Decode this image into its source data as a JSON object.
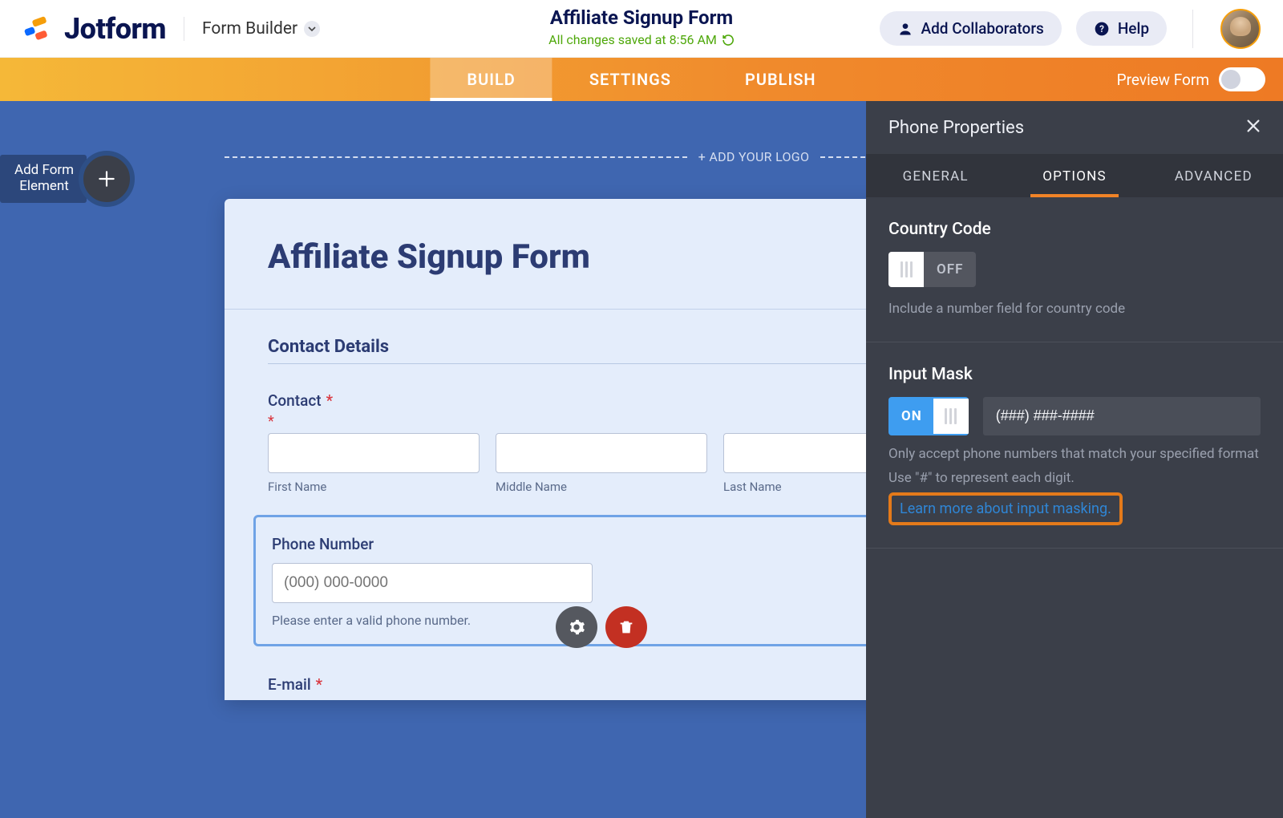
{
  "header": {
    "brand": "Jotform",
    "builder_label": "Form Builder",
    "form_title": "Affiliate Signup Form",
    "saved_text": "All changes saved at 8:56 AM",
    "collaborators_label": "Add Collaborators",
    "help_label": "Help"
  },
  "modebar": {
    "tabs": [
      "BUILD",
      "SETTINGS",
      "PUBLISH"
    ],
    "active": "BUILD",
    "preview_label": "Preview Form"
  },
  "side": {
    "add_label_1": "Add Form",
    "add_label_2": "Element"
  },
  "canvas": {
    "add_logo": "+ ADD YOUR LOGO",
    "form_heading": "Affiliate Signup Form",
    "section_contact_details": "Contact Details",
    "contact_label": "Contact",
    "sub_first": "First Name",
    "sub_middle": "Middle Name",
    "sub_last": "Last Name",
    "phone_label": "Phone Number",
    "phone_placeholder": "(000) 000-0000",
    "phone_help": "Please enter a valid phone number.",
    "email_label": "E-mail"
  },
  "panel": {
    "title": "Phone Properties",
    "tabs": [
      "GENERAL",
      "OPTIONS",
      "ADVANCED"
    ],
    "active": "OPTIONS",
    "country_code": {
      "title": "Country Code",
      "state": "OFF",
      "desc": "Include a number field for country code"
    },
    "input_mask": {
      "title": "Input Mask",
      "state": "ON",
      "value": "(###) ###-####",
      "desc1": "Only accept phone numbers that match your specified format",
      "desc2": "Use \"#\" to represent each digit.",
      "link": "Learn more about input masking."
    }
  }
}
